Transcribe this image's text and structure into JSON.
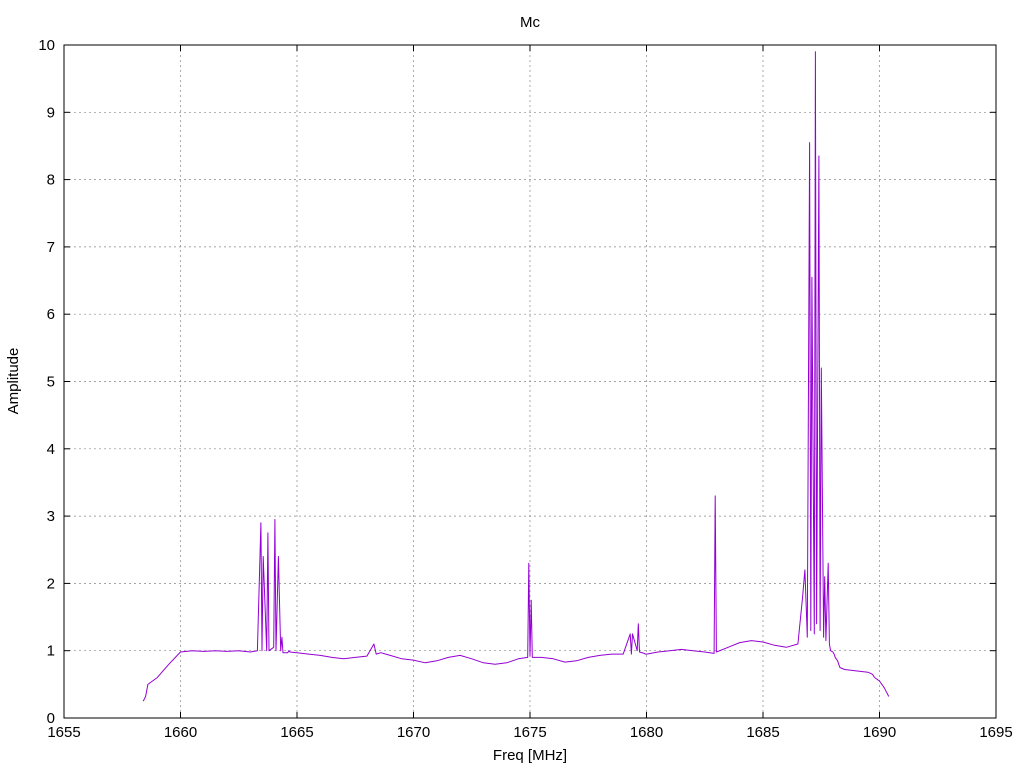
{
  "chart_data": {
    "type": "line",
    "title": "Mc",
    "xlabel": "Freq [MHz]",
    "ylabel": "Amplitude",
    "xlim": [
      1655,
      1695
    ],
    "ylim": [
      0,
      10
    ],
    "xticks": [
      1655,
      1660,
      1665,
      1670,
      1675,
      1680,
      1685,
      1690,
      1695
    ],
    "yticks": [
      0,
      1,
      2,
      3,
      4,
      5,
      6,
      7,
      8,
      9,
      10
    ],
    "grid": true,
    "legend": "none",
    "series": [
      {
        "color": "#9400d3",
        "x": [
          1658.4,
          1658.5,
          1658.6,
          1659.0,
          1659.5,
          1660.0,
          1660.5,
          1661.0,
          1661.5,
          1662.0,
          1662.5,
          1663.0,
          1663.3,
          1663.45,
          1663.5,
          1663.55,
          1663.7,
          1663.75,
          1663.8,
          1664.0,
          1664.05,
          1664.1,
          1664.2,
          1664.3,
          1664.35,
          1664.4,
          1664.6,
          1664.65,
          1664.7,
          1665.0,
          1665.5,
          1666.0,
          1666.5,
          1667.0,
          1667.5,
          1668.0,
          1668.3,
          1668.4,
          1668.6,
          1669.0,
          1669.5,
          1670.0,
          1670.5,
          1671.0,
          1671.5,
          1672.0,
          1672.5,
          1673.0,
          1673.5,
          1674.0,
          1674.5,
          1674.9,
          1674.95,
          1675.0,
          1675.05,
          1675.1,
          1675.5,
          1676.0,
          1676.5,
          1677.0,
          1677.5,
          1678.0,
          1678.5,
          1679.0,
          1679.3,
          1679.35,
          1679.4,
          1679.6,
          1679.65,
          1679.7,
          1679.9,
          1679.95,
          1680.0,
          1680.5,
          1681.0,
          1681.5,
          1682.0,
          1682.5,
          1682.9,
          1682.95,
          1683.0,
          1683.5,
          1684.0,
          1684.5,
          1685.0,
          1685.5,
          1686.0,
          1686.5,
          1686.7,
          1686.8,
          1686.9,
          1687.0,
          1687.05,
          1687.1,
          1687.2,
          1687.25,
          1687.3,
          1687.4,
          1687.45,
          1687.5,
          1687.6,
          1687.65,
          1687.7,
          1687.8,
          1687.85,
          1687.9,
          1688.0,
          1688.05,
          1688.1,
          1688.2,
          1688.25,
          1688.3,
          1688.5,
          1689.0,
          1689.5,
          1689.7,
          1689.75,
          1689.8,
          1690.0,
          1690.2,
          1690.4
        ],
        "y": [
          0.25,
          0.32,
          0.5,
          0.6,
          0.8,
          0.98,
          1.0,
          0.99,
          1.0,
          0.99,
          1.0,
          0.98,
          1.0,
          2.9,
          1.0,
          2.4,
          1.0,
          2.75,
          1.0,
          1.05,
          2.95,
          1.0,
          2.4,
          1.0,
          1.2,
          0.97,
          0.97,
          1.0,
          0.98,
          0.97,
          0.95,
          0.93,
          0.9,
          0.88,
          0.9,
          0.92,
          1.1,
          0.95,
          0.97,
          0.93,
          0.88,
          0.86,
          0.82,
          0.85,
          0.9,
          0.93,
          0.88,
          0.82,
          0.8,
          0.82,
          0.88,
          0.9,
          2.3,
          0.92,
          1.75,
          0.9,
          0.9,
          0.88,
          0.83,
          0.85,
          0.9,
          0.93,
          0.95,
          0.95,
          1.25,
          0.95,
          1.25,
          1.0,
          1.4,
          0.98,
          0.96,
          0.95,
          0.95,
          0.98,
          1.0,
          1.02,
          1.0,
          0.98,
          0.96,
          3.3,
          0.98,
          1.05,
          1.12,
          1.15,
          1.13,
          1.08,
          1.05,
          1.1,
          1.8,
          2.2,
          1.2,
          8.55,
          1.3,
          6.55,
          1.25,
          9.9,
          1.4,
          8.35,
          1.3,
          5.2,
          1.2,
          2.1,
          1.15,
          2.3,
          1.1,
          1.0,
          0.98,
          0.95,
          0.9,
          0.85,
          0.8,
          0.75,
          0.72,
          0.7,
          0.68,
          0.65,
          0.62,
          0.6,
          0.55,
          0.45,
          0.32
        ]
      }
    ]
  }
}
